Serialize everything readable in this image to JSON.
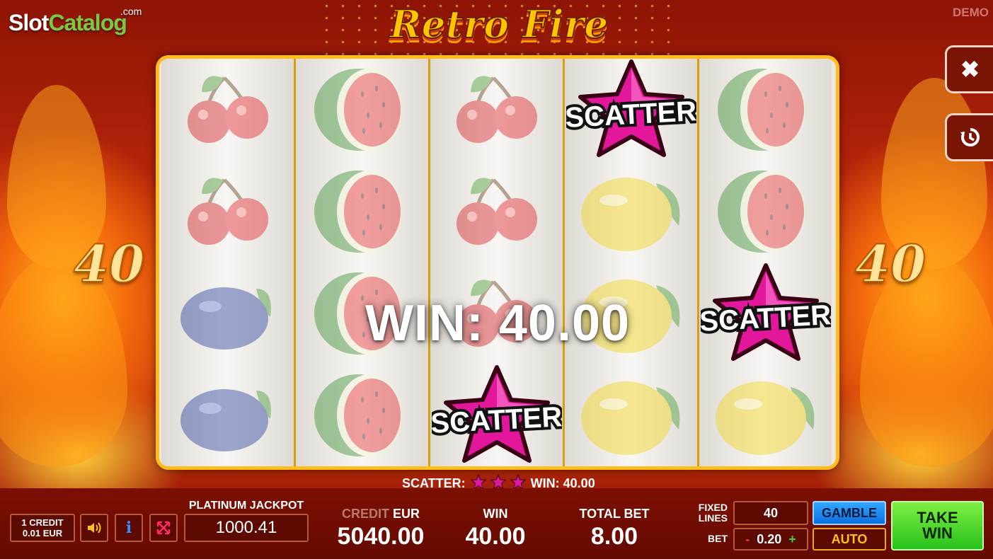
{
  "branding": {
    "site_logo_main": "Slot",
    "site_logo_accent": "Catalog",
    "site_logo_suffix": ".com",
    "demo_badge": "DEMO"
  },
  "game": {
    "title": "Retro Fire"
  },
  "side_controls": {
    "close_icon": "close-icon",
    "history_icon": "history-icon"
  },
  "paylines": {
    "left_value": "40",
    "right_value": "40"
  },
  "reels": [
    [
      "cherry",
      "cherry",
      "plum",
      "plum"
    ],
    [
      "watermelon",
      "watermelon",
      "watermelon",
      "watermelon"
    ],
    [
      "cherry",
      "cherry",
      "cherry",
      "scatter"
    ],
    [
      "scatter",
      "lemon",
      "lemon",
      "lemon"
    ],
    [
      "watermelon",
      "watermelon",
      "scatter",
      "lemon"
    ]
  ],
  "scatter_label": "SCATTER",
  "win_overlay": "WIN: 40.00",
  "scatter_summary": {
    "label": "SCATTER:",
    "star_count": 3,
    "win_text": "WIN: 40.00"
  },
  "bottom_bar": {
    "credit_value_line1": "1 CREDIT",
    "credit_value_line2": "0.01 EUR",
    "sound_icon": "speaker-icon",
    "info_icon": "info-icon",
    "fullscreen_icon": "fullscreen-icon",
    "jackpot_label": "PLATINUM JACKPOT",
    "jackpot_value": "1000.41",
    "credit_label_dim": "CREDIT",
    "credit_label_currency": "EUR",
    "credit_amount": "5040.00",
    "win_label": "WIN",
    "win_amount": "40.00",
    "total_bet_label": "TOTAL BET",
    "total_bet_amount": "8.00",
    "fixed_lines_label_1": "FIXED",
    "fixed_lines_label_2": "LINES",
    "fixed_lines_value": "40",
    "bet_label": "BET",
    "bet_minus": "-",
    "bet_value": "0.20",
    "bet_plus": "+",
    "gamble_label": "GAMBLE",
    "auto_label": "AUTO",
    "take_win_line1": "TAKE",
    "take_win_line2": "WIN"
  },
  "colors": {
    "frame": "#ffbc1c",
    "scatter_star": "#e2179b",
    "take_win": "#3fd423",
    "gamble": "#1a86ee",
    "auto_text": "#ffc21c"
  }
}
